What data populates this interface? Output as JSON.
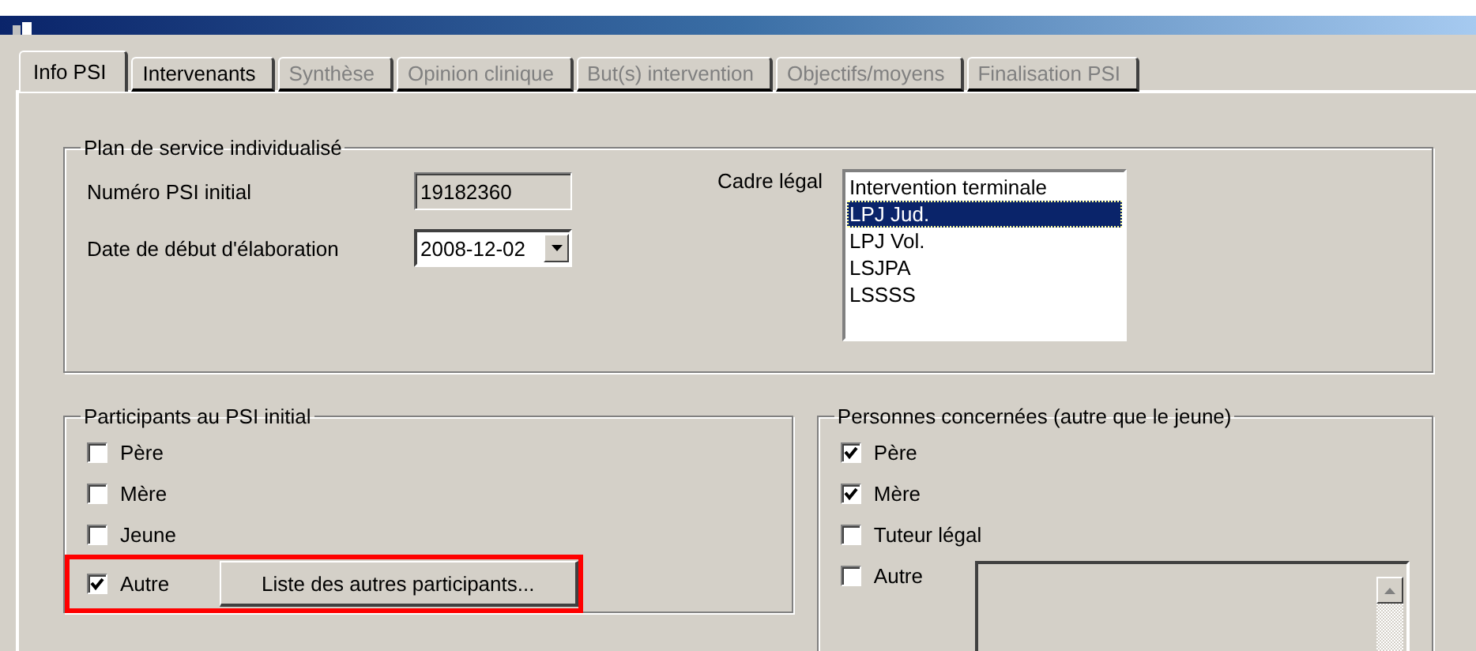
{
  "tabs": [
    {
      "label": "Info PSI",
      "selected": true,
      "disabled": false
    },
    {
      "label": "Intervenants",
      "selected": false,
      "disabled": false
    },
    {
      "label": "Synthèse",
      "selected": false,
      "disabled": true
    },
    {
      "label": "Opinion clinique",
      "selected": false,
      "disabled": true
    },
    {
      "label": "But(s) intervention",
      "selected": false,
      "disabled": true
    },
    {
      "label": "Objectifs/moyens",
      "selected": false,
      "disabled": true
    },
    {
      "label": "Finalisation PSI",
      "selected": false,
      "disabled": true
    }
  ],
  "plan": {
    "title": "Plan de service individualisé",
    "numero": {
      "label": "Numéro PSI initial",
      "value": "19182360"
    },
    "date": {
      "label": "Date de début d'élaboration",
      "value": "2008-12-02"
    },
    "cadre": {
      "label": "Cadre légal",
      "options": [
        {
          "label": "Intervention terminale",
          "selected": false
        },
        {
          "label": "LPJ Jud.",
          "selected": true
        },
        {
          "label": "LPJ Vol.",
          "selected": false
        },
        {
          "label": "LSJPA",
          "selected": false
        },
        {
          "label": "LSSSS",
          "selected": false
        }
      ]
    }
  },
  "participants": {
    "title": "Participants au PSI initial",
    "items": [
      {
        "label": "Père",
        "checked": false
      },
      {
        "label": "Mère",
        "checked": false
      },
      {
        "label": "Jeune",
        "checked": false
      },
      {
        "label": "Autre",
        "checked": true
      }
    ],
    "button": "Liste des autres participants..."
  },
  "personnes": {
    "title": "Personnes concernées (autre que le jeune)",
    "items": [
      {
        "label": "Père",
        "checked": true
      },
      {
        "label": "Mère",
        "checked": true
      },
      {
        "label": "Tuteur légal",
        "checked": false
      },
      {
        "label": "Autre",
        "checked": false
      }
    ]
  }
}
